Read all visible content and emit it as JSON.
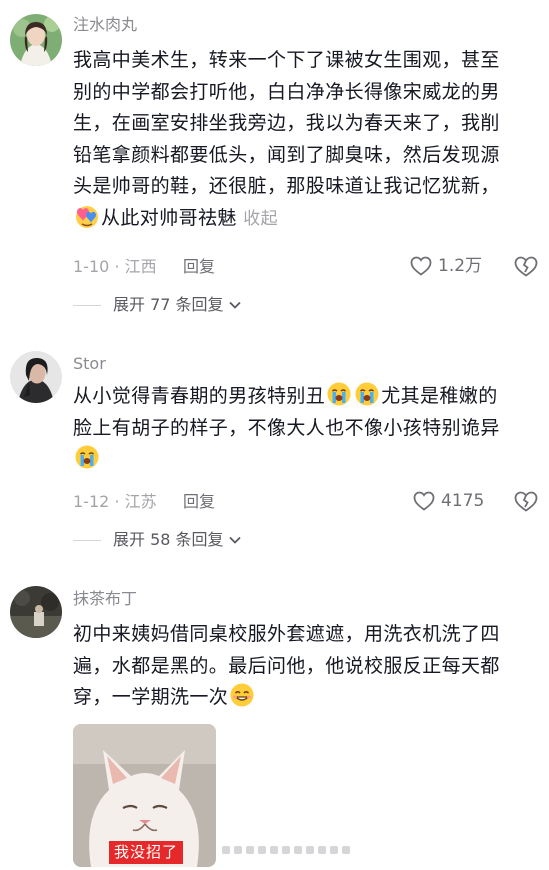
{
  "comments": [
    {
      "username": "注水肉丸",
      "lines": [
        "我高中美术生，转来一个下了课被女生围观，甚至",
        "别的中学都会打听他，白白净净长得像宋威龙的男",
        "生，在画室安排坐我旁边，我以为春天来了，我削",
        "铅笔拿颜料都要低头，闻到了脚臭味，然后发现源",
        "头是帅哥的鞋，还很脏，那股味道让我记忆犹新，"
      ],
      "last_line": "从此对帅哥祛魅",
      "collapse_label": "收起",
      "emoji": "sparkling-hearts-emoji",
      "meta": "1-10 · 江西",
      "reply_label": "回复",
      "likes": "1.2万",
      "expand_label": "展开 77 条回复"
    },
    {
      "username": "Stor",
      "line1_text": "从小觉得青春期的男孩特别丑",
      "line1_tail": "尤其是稚嫩的",
      "line2": "脸上有胡子的样子，不像大人也不像小孩特别诡异",
      "emoji": "loudly-crying-face-emoji",
      "meta": "1-12 · 江苏",
      "reply_label": "回复",
      "likes": "4175",
      "expand_label": "展开 58 条回复"
    },
    {
      "username": "抹茶布丁",
      "lines": [
        "初中来姨妈借同桌校服外套遮遮，用洗衣机洗了四",
        "遍，水都是黑的。最后问他，他说校服反正每天都"
      ],
      "last_line": "穿，一学期洗一次",
      "emoji": "smiling-face-emoji",
      "sticker_caption": "我没招了"
    }
  ],
  "colors": {
    "text": "#161823",
    "muted": "#a4a5aa",
    "username": "#8a8b91",
    "caption_bg": "#e5292a"
  }
}
